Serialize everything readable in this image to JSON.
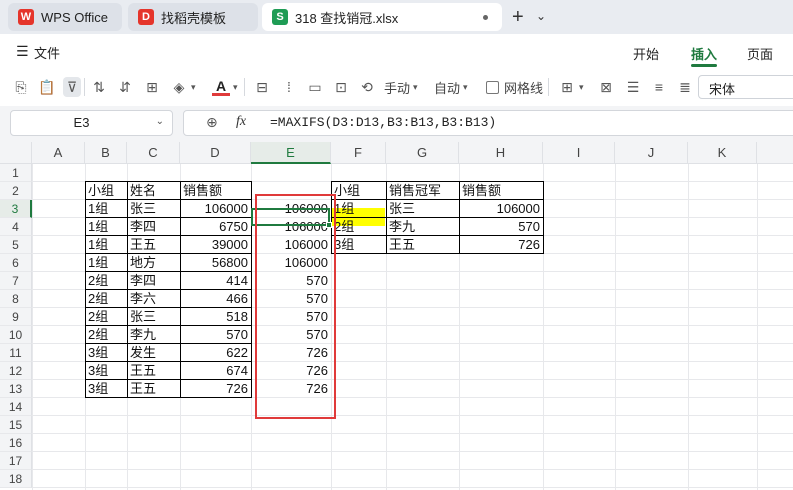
{
  "tabs": [
    {
      "label": "WPS Office",
      "icon": "wps-logo-icon",
      "color": "#e5352b"
    },
    {
      "label": "找稻壳模板",
      "icon": "docer-icon",
      "color": "#e5352b"
    },
    {
      "label": "318 查找销冠.xlsx",
      "icon": "spreadsheet-icon",
      "color": "#1f9c55"
    }
  ],
  "menubar": {
    "file_label": "文件",
    "tabs": [
      "开始",
      "插入",
      "页面"
    ],
    "active_tab": "插入"
  },
  "toolbar": {
    "manual_label": "手动",
    "auto_label": "自动",
    "gridline_label": "网格线",
    "font_name": "宋体"
  },
  "formula_bar": {
    "cell_ref": "E3",
    "fx": "fx",
    "formula": "=MAXIFS(D3:D13,B3:B13,B3:B13)"
  },
  "columns": [
    "A",
    "B",
    "C",
    "D",
    "E",
    "F",
    "G",
    "H",
    "I",
    "J",
    "K"
  ],
  "rows": [
    "1",
    "2",
    "3",
    "4",
    "5",
    "6",
    "7",
    "8",
    "9",
    "10",
    "11",
    "12",
    "13",
    "14",
    "15",
    "16",
    "17",
    "18"
  ],
  "active_cell": "E3",
  "colors": {
    "accent": "#1f7a3f",
    "highlight": "#ffff00",
    "annotation": "#e03a3a"
  },
  "table_left": {
    "headers": [
      "小组",
      "姓名",
      "销售额"
    ],
    "rows": [
      [
        "1组",
        "张三",
        "106000"
      ],
      [
        "1组",
        "李四",
        "6750"
      ],
      [
        "1组",
        "王五",
        "39000"
      ],
      [
        "1组",
        "地方",
        "56800"
      ],
      [
        "2组",
        "李四",
        "414"
      ],
      [
        "2组",
        "李六",
        "466"
      ],
      [
        "2组",
        "张三",
        "518"
      ],
      [
        "2组",
        "李九",
        "570"
      ],
      [
        "3组",
        "发生",
        "622"
      ],
      [
        "3组",
        "王五",
        "674"
      ],
      [
        "3组",
        "王五",
        "726"
      ]
    ]
  },
  "column_e": [
    "106000",
    "106000",
    "106000",
    "106000",
    "570",
    "570",
    "570",
    "570",
    "726",
    "726",
    "726"
  ],
  "table_right": {
    "headers": [
      "小组",
      "销售冠军",
      "销售额"
    ],
    "rows": [
      [
        "1组",
        "张三",
        "106000"
      ],
      [
        "2组",
        "李九",
        "570"
      ],
      [
        "3组",
        "王五",
        "726"
      ]
    ]
  }
}
